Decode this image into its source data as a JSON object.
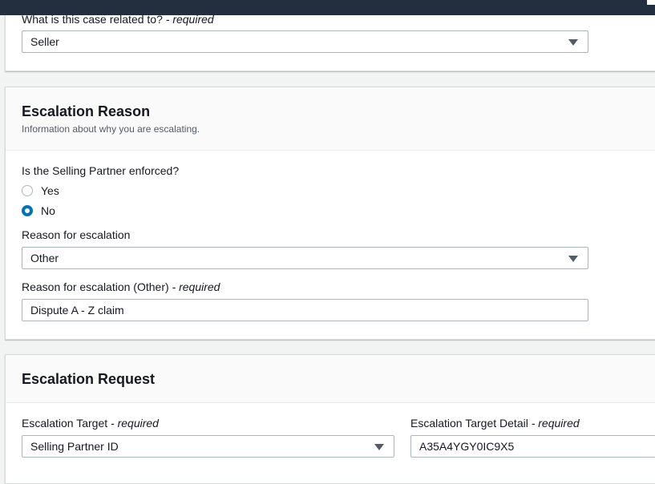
{
  "case_related": {
    "label": "What is this case related to?",
    "required_text": "- required",
    "value": "Seller"
  },
  "escalation_reason": {
    "title": "Escalation Reason",
    "description": "Information about why you are escalating.",
    "enforced_question": "Is the Selling Partner enforced?",
    "options": [
      {
        "label": "Yes",
        "checked": false
      },
      {
        "label": "No",
        "checked": true
      }
    ],
    "reason_label": "Reason for escalation",
    "reason_value": "Other",
    "other_label": "Reason for escalation (Other)",
    "other_required": "- required",
    "other_value": "Dispute A - Z claim"
  },
  "escalation_request": {
    "title": "Escalation Request",
    "target_label": "Escalation Target",
    "target_required": "- required",
    "target_value": "Selling Partner ID",
    "detail_label": "Escalation Target Detail",
    "detail_required": "- required",
    "detail_value": "A35A4YGY0IC9X5"
  }
}
